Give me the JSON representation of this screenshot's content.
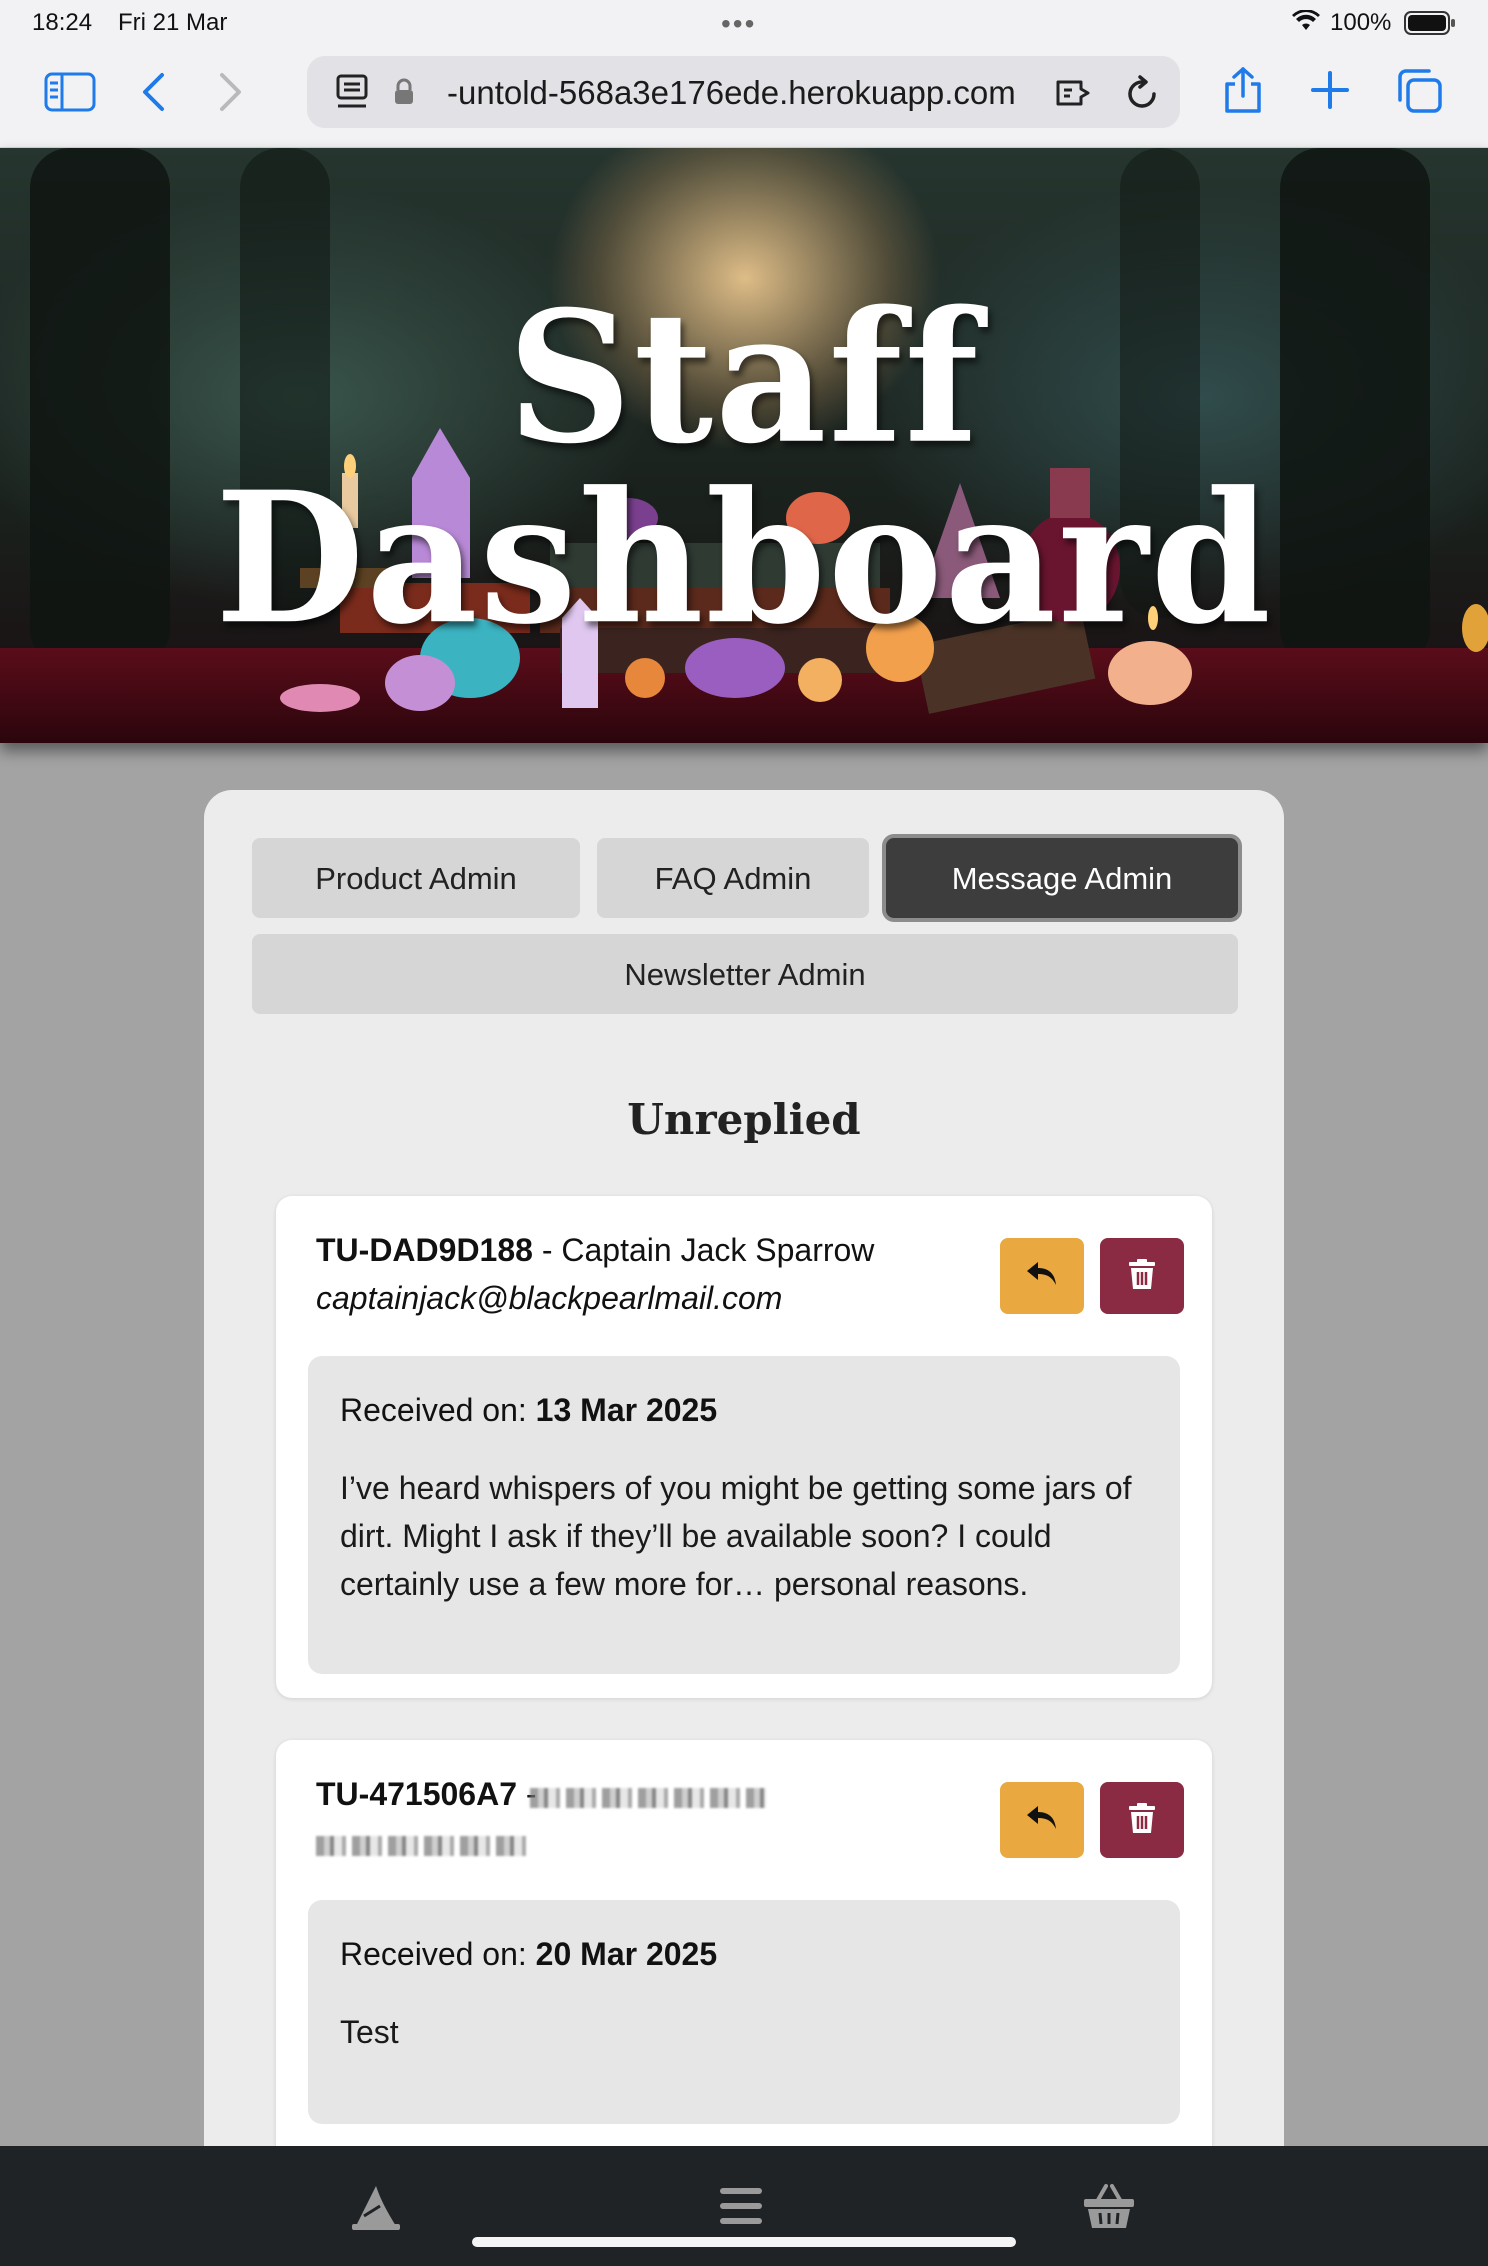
{
  "status_bar": {
    "time": "18:24",
    "date": "Fri 21 Mar",
    "battery_percent": "100%"
  },
  "browser": {
    "url": "-untold-568a3e176ede.herokuapp.com"
  },
  "hero": {
    "title": "Staff Dashboard"
  },
  "tabs": [
    {
      "label": "Product Admin",
      "active": false
    },
    {
      "label": "FAQ Admin",
      "active": false
    },
    {
      "label": "Message Admin",
      "active": true
    },
    {
      "label": "Newsletter Admin",
      "active": false
    }
  ],
  "section": {
    "title": "Unreplied"
  },
  "messages": [
    {
      "ref": "TU-DAD9D188",
      "separator": "-",
      "name": "Captain Jack Sparrow",
      "email": "captainjack@blackpearlmail.com",
      "received_label": "Received on:",
      "received_date": "13 Mar 2025",
      "text": "I’ve heard whispers of you might be getting some jars of dirt. Might I ask if they’ll be available soon? I could certainly use a few more for… personal reasons."
    },
    {
      "ref": "TU-471506A7",
      "separator": "-",
      "name": "",
      "email": "",
      "received_label": "Received on:",
      "received_date": "20 Mar 2025",
      "text": "Test"
    }
  ],
  "colors": {
    "reply_button": "#eaa840",
    "delete_button": "#8a2a43",
    "active_tab": "#3d3d3d",
    "page_background": "#a3a3a3",
    "bottom_bar": "#1f2325"
  },
  "icons": {
    "reply": "reply-arrow-icon",
    "delete": "trash-icon",
    "bottom_left": "wizard-hat-icon",
    "bottom_center": "hamburger-menu-icon",
    "bottom_right": "basket-icon"
  }
}
